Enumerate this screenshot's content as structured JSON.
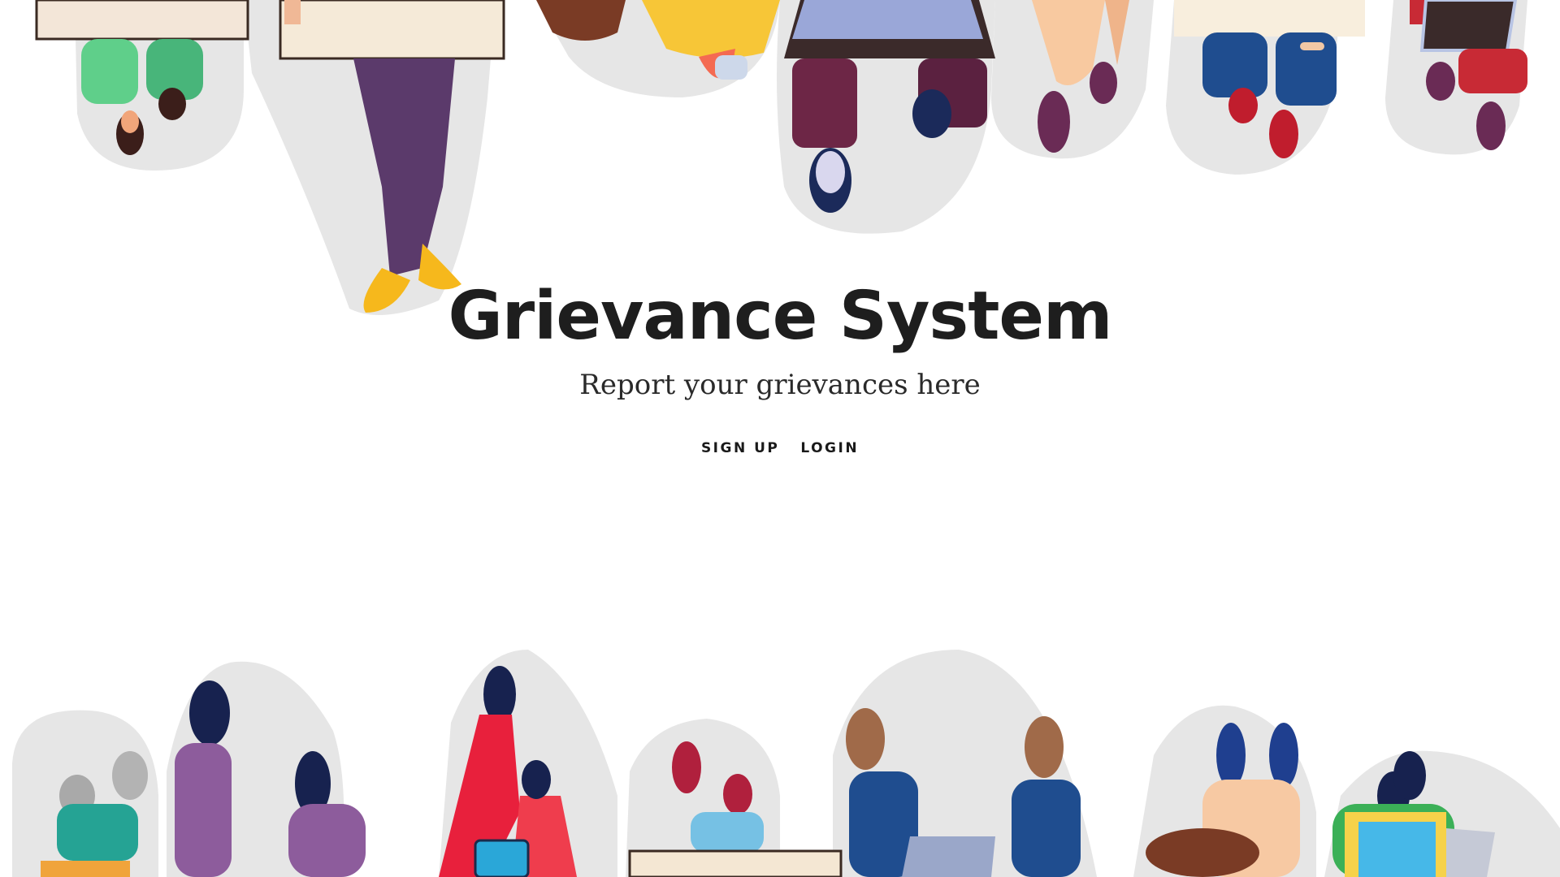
{
  "hero": {
    "title": "Grievance System",
    "subtitle": "Report your grievances here"
  },
  "nav": {
    "signup_label": "SIGN UP",
    "login_label": "LOGIN"
  },
  "illustration": {
    "top_people": [
      "reader",
      "reader",
      "bag-carrier",
      "laptop-user",
      "walker",
      "reader",
      "tablet-user"
    ],
    "bottom_people": [
      "reader",
      "walker",
      "tablet-user",
      "reader",
      "laptop-user",
      "bag-carrier",
      "reader"
    ]
  }
}
